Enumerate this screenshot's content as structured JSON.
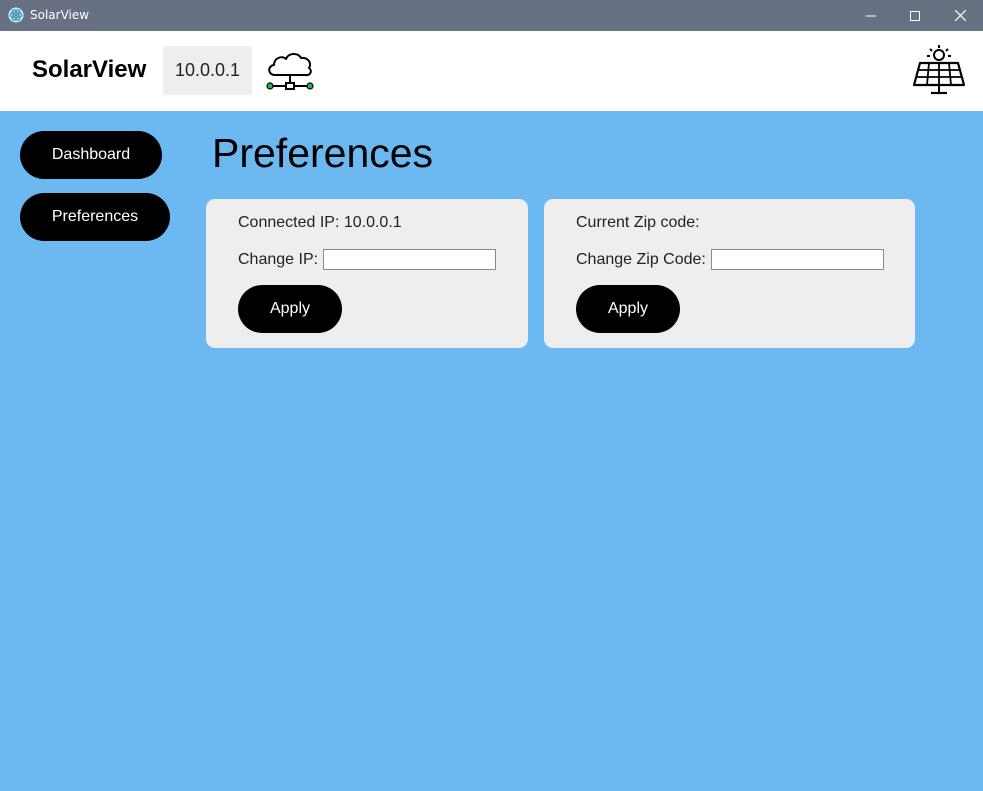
{
  "window": {
    "title": "SolarView"
  },
  "header": {
    "brand": "SolarView",
    "ip_badge": "10.0.0.1",
    "icons": [
      "cloud-network-icon",
      "solar-panel-icon"
    ]
  },
  "sidebar": {
    "items": [
      {
        "label": "Dashboard"
      },
      {
        "label": "Preferences"
      }
    ]
  },
  "main": {
    "title": "Preferences",
    "ip_card": {
      "connected_label": "Connected IP: 10.0.0.1",
      "change_label": "Change IP:",
      "input_value": "",
      "apply_label": "Apply"
    },
    "zip_card": {
      "current_label": "Current Zip code:",
      "change_label": "Change Zip Code:",
      "input_value": "",
      "apply_label": "Apply"
    }
  },
  "colors": {
    "titlebar": "#677183",
    "background": "#6cb8f0",
    "card": "#eeeeee",
    "button": "#000000",
    "accent_green": "#1db954"
  }
}
